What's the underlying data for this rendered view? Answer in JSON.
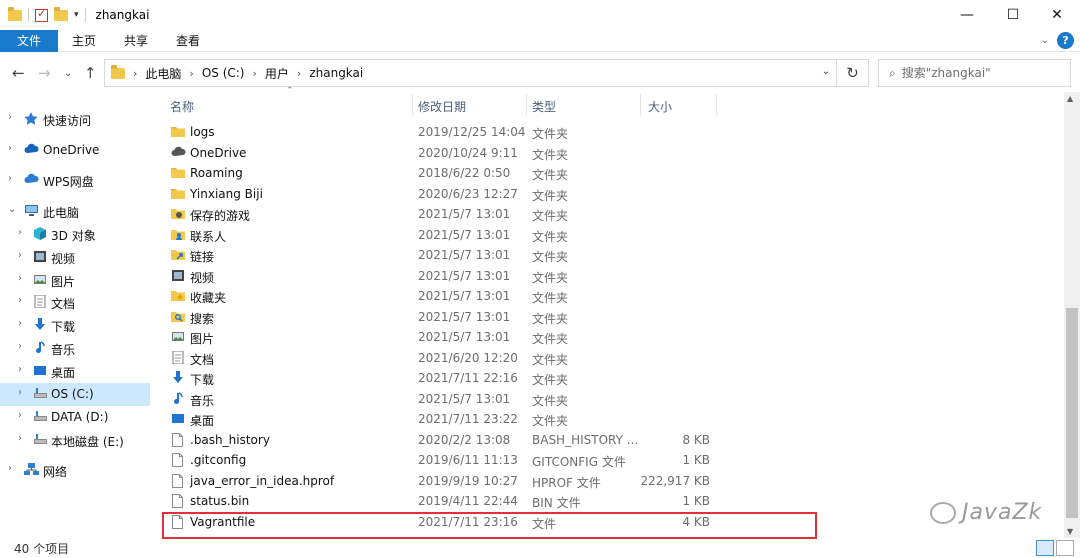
{
  "window": {
    "title": "zhangkai",
    "controls": {
      "minimize": "—",
      "maximize": "☐",
      "close": "✕"
    }
  },
  "ribbon": {
    "tabs": [
      "文件",
      "主页",
      "共享",
      "查看"
    ]
  },
  "address": {
    "crumbs": [
      "此电脑",
      "OS (C:)",
      "用户",
      "zhangkai"
    ]
  },
  "search": {
    "placeholder": "搜索\"zhangkai\""
  },
  "nav": {
    "items": [
      {
        "label": "快速访问",
        "icon": "star-icon",
        "color": "#2b7cd3"
      },
      {
        "label": "OneDrive",
        "icon": "cloud-icon",
        "color": "#1565c0"
      },
      {
        "label": "WPS网盘",
        "icon": "cloud-icon",
        "color": "#2b7cd3"
      },
      {
        "label": "此电脑",
        "icon": "computer-icon",
        "color": "#2f6cb3"
      },
      {
        "label": "3D 对象",
        "icon": "cube-icon",
        "color": "#2bb3d3"
      },
      {
        "label": "视频",
        "icon": "film-icon",
        "color": "#444444"
      },
      {
        "label": "图片",
        "icon": "picture-icon",
        "color": "#666666"
      },
      {
        "label": "文档",
        "icon": "document-icon",
        "color": "#777777"
      },
      {
        "label": "下载",
        "icon": "download-icon",
        "color": "#1f73d1"
      },
      {
        "label": "音乐",
        "icon": "music-icon",
        "color": "#1f73d1"
      },
      {
        "label": "桌面",
        "icon": "desktop-icon",
        "color": "#1f73d1"
      },
      {
        "label": "OS (C:)",
        "icon": "drive-icon",
        "color": "#555555"
      },
      {
        "label": "DATA (D:)",
        "icon": "drive-icon",
        "color": "#555555"
      },
      {
        "label": "本地磁盘 (E:)",
        "icon": "drive-icon",
        "color": "#555555"
      },
      {
        "label": "网络",
        "icon": "network-icon",
        "color": "#2b7cd3"
      }
    ]
  },
  "columns": {
    "name": "名称",
    "date": "修改日期",
    "type": "类型",
    "size": "大小"
  },
  "files": [
    {
      "name": "logs",
      "date": "2019/12/25 14:04",
      "type": "文件夹",
      "size": "",
      "icon": "folder-icon"
    },
    {
      "name": "OneDrive",
      "date": "2020/10/24 9:11",
      "type": "文件夹",
      "size": "",
      "icon": "cloud-icon"
    },
    {
      "name": "Roaming",
      "date": "2018/6/22 0:50",
      "type": "文件夹",
      "size": "",
      "icon": "folder-icon"
    },
    {
      "name": "Yinxiang Biji",
      "date": "2020/6/23 12:27",
      "type": "文件夹",
      "size": "",
      "icon": "folder-icon"
    },
    {
      "name": "保存的游戏",
      "date": "2021/5/7 13:01",
      "type": "文件夹",
      "size": "",
      "icon": "saved-games-icon"
    },
    {
      "name": "联系人",
      "date": "2021/5/7 13:01",
      "type": "文件夹",
      "size": "",
      "icon": "contacts-icon"
    },
    {
      "name": "链接",
      "date": "2021/5/7 13:01",
      "type": "文件夹",
      "size": "",
      "icon": "links-icon"
    },
    {
      "name": "视频",
      "date": "2021/5/7 13:01",
      "type": "文件夹",
      "size": "",
      "icon": "film-icon"
    },
    {
      "name": "收藏夹",
      "date": "2021/5/7 13:01",
      "type": "文件夹",
      "size": "",
      "icon": "favorites-icon"
    },
    {
      "name": "搜索",
      "date": "2021/5/7 13:01",
      "type": "文件夹",
      "size": "",
      "icon": "search-folder-icon"
    },
    {
      "name": "图片",
      "date": "2021/5/7 13:01",
      "type": "文件夹",
      "size": "",
      "icon": "picture-icon"
    },
    {
      "name": "文档",
      "date": "2021/6/20 12:20",
      "type": "文件夹",
      "size": "",
      "icon": "document-icon"
    },
    {
      "name": "下载",
      "date": "2021/7/11 22:16",
      "type": "文件夹",
      "size": "",
      "icon": "download-icon"
    },
    {
      "name": "音乐",
      "date": "2021/5/7 13:01",
      "type": "文件夹",
      "size": "",
      "icon": "music-icon"
    },
    {
      "name": "桌面",
      "date": "2021/7/11 23:22",
      "type": "文件夹",
      "size": "",
      "icon": "desktop-icon"
    },
    {
      "name": ".bash_history",
      "date": "2020/2/2 13:08",
      "type": "BASH_HISTORY ...",
      "size": "8 KB",
      "icon": "file-icon"
    },
    {
      "name": ".gitconfig",
      "date": "2019/6/11 11:13",
      "type": "GITCONFIG 文件",
      "size": "1 KB",
      "icon": "file-icon"
    },
    {
      "name": "java_error_in_idea.hprof",
      "date": "2019/9/19 10:27",
      "type": "HPROF 文件",
      "size": "222,917 KB",
      "icon": "file-icon"
    },
    {
      "name": "status.bin",
      "date": "2019/4/11 22:44",
      "type": "BIN 文件",
      "size": "1 KB",
      "icon": "file-icon"
    },
    {
      "name": "Vagrantfile",
      "date": "2021/7/11 23:16",
      "type": "文件",
      "size": "4 KB",
      "icon": "file-icon"
    }
  ],
  "status": {
    "count": "40 个项目"
  },
  "watermark": {
    "text": "JavaZk"
  },
  "colors": {
    "accent": "#1979ca",
    "selection": "#cce8ff",
    "highlight_box": "#e0303a"
  }
}
